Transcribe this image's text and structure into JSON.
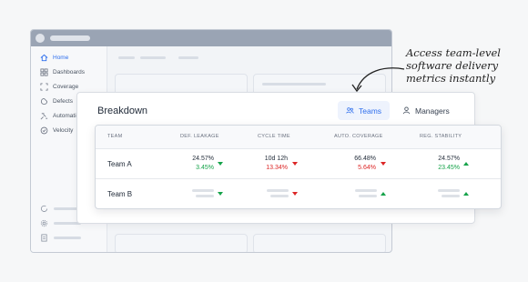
{
  "sidebar": {
    "items": [
      {
        "label": "Home",
        "icon": "home-icon",
        "active": true
      },
      {
        "label": "Dashboards",
        "icon": "grid-icon"
      },
      {
        "label": "Coverage",
        "icon": "frame-icon"
      },
      {
        "label": "Defects",
        "icon": "bug-icon"
      },
      {
        "label": "Automation",
        "icon": "automation-icon"
      },
      {
        "label": "Velocity",
        "icon": "gauge-icon"
      }
    ]
  },
  "annotation": {
    "line1": "Access team-level",
    "line2": "software delivery",
    "line3": "metrics instantly"
  },
  "breakdown": {
    "title": "Breakdown",
    "tabs": [
      {
        "label": "Teams",
        "icon": "users-icon",
        "active": true
      },
      {
        "label": "Managers",
        "icon": "user-icon"
      }
    ]
  },
  "table": {
    "headers": [
      "TEAM",
      "DEF. LEAKAGE",
      "CYCLE TIME",
      "AUTO. COVERAGE",
      "REG. STABILITY"
    ],
    "rows": [
      {
        "team": "Team A",
        "def_leakage": {
          "value": "24.57%",
          "delta": "3.45%"
        },
        "cycle_time": {
          "value": "10d 12h",
          "delta": "13.34%"
        },
        "auto_coverage": {
          "value": "66.48%",
          "delta": "5.64%"
        },
        "reg_stability": {
          "value": "24.57%",
          "delta": "23.45%"
        }
      },
      {
        "team": "Team B"
      }
    ]
  },
  "colors": {
    "accent": "#2f6fed",
    "positive": "#16a34a",
    "negative": "#dc2626"
  }
}
